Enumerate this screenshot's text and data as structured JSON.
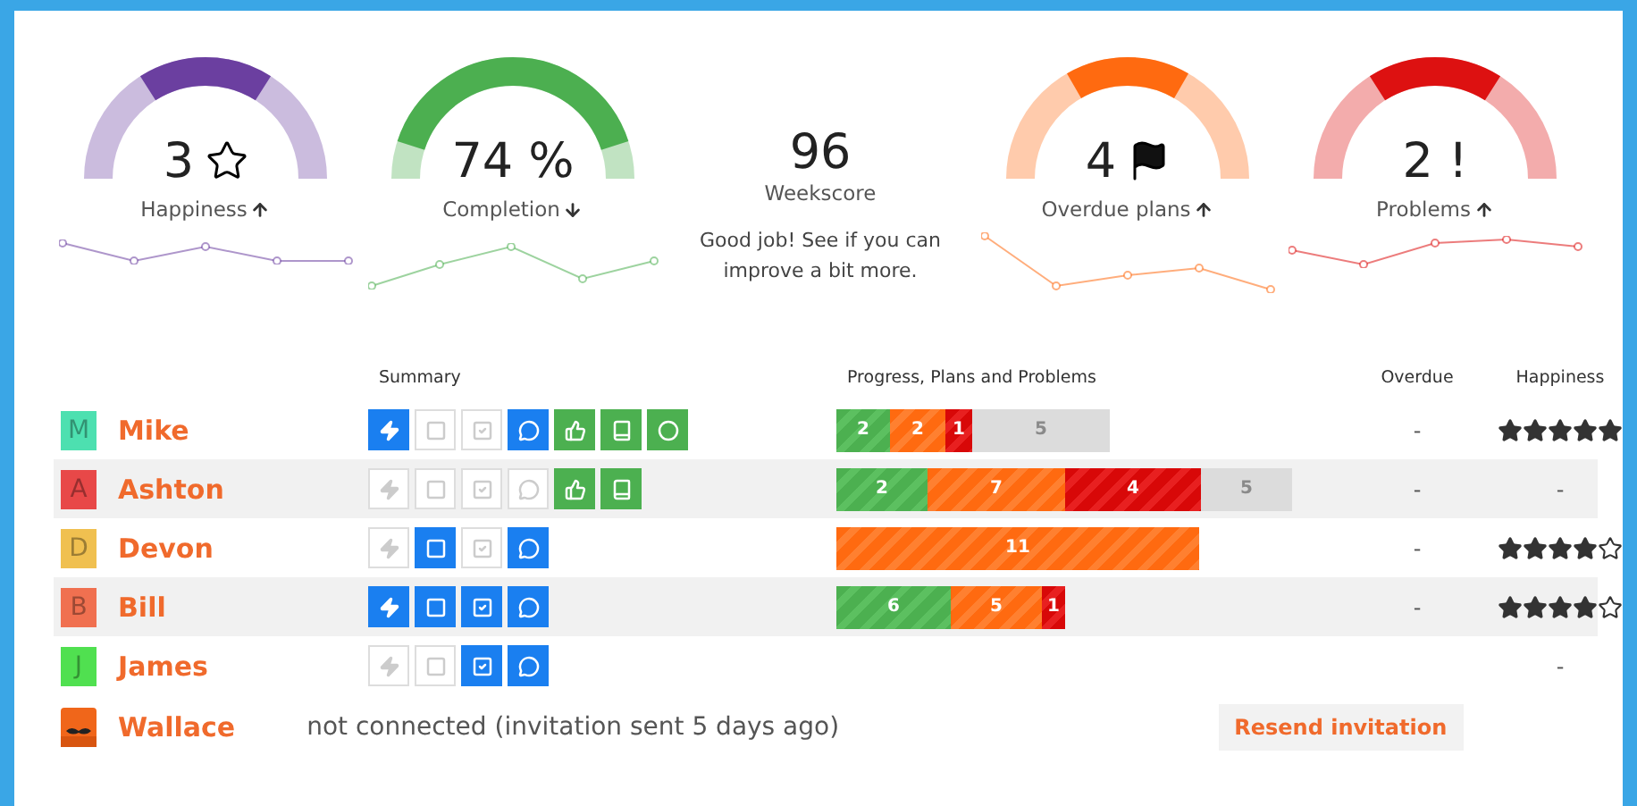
{
  "stats": [
    {
      "kind": "happiness",
      "value": "3",
      "label": "Happiness",
      "color": "#6b3fa0"
    },
    {
      "kind": "completion",
      "value": "74 %",
      "label": "Completion",
      "color": "#4caf50"
    },
    {
      "kind": "score",
      "value": "96",
      "label": "Weekscore",
      "note": "Good job! See if you can improve a bit more."
    },
    {
      "kind": "overdue",
      "value": "4",
      "label": "Overdue plans",
      "color": "#ff6a10"
    },
    {
      "kind": "problems",
      "value": "2 !",
      "label": "Problems",
      "color": "#dd1111"
    }
  ],
  "table": {
    "columns": [
      "Summary",
      "Progress, Plans and Problems",
      "Overdue",
      "Happiness"
    ],
    "rows": [
      {
        "initial": "M",
        "name": "Mike",
        "summary": [
          {
            "kind": "bolt",
            "on": true
          },
          {
            "kind": "square",
            "on": false
          },
          {
            "kind": "check",
            "on": false
          },
          {
            "kind": "chat",
            "on": true
          }
        ],
        "badges": [
          {
            "kind": "thumbs"
          },
          {
            "kind": "book"
          },
          {
            "kind": "circle"
          }
        ],
        "bar": [
          {
            "kind": "done",
            "value": "2"
          },
          {
            "kind": "plan",
            "value": "2"
          },
          {
            "kind": "problem",
            "value": "1"
          },
          {
            "kind": "rest",
            "value": "5"
          }
        ],
        "overdue": "-",
        "stars": 5
      },
      {
        "initial": "A",
        "name": "Ashton",
        "summary": [
          {
            "kind": "bolt",
            "on": false
          },
          {
            "kind": "square",
            "on": false
          },
          {
            "kind": "check",
            "on": false
          },
          {
            "kind": "chat",
            "on": false
          }
        ],
        "badges": [
          {
            "kind": "thumbs"
          },
          {
            "kind": "book"
          }
        ],
        "bar": [
          {
            "kind": "done",
            "value": "2"
          },
          {
            "kind": "plan",
            "value": "7"
          },
          {
            "kind": "problem",
            "value": "4"
          },
          {
            "kind": "rest",
            "value": "5"
          }
        ],
        "overdue": "-",
        "happiness": "-"
      },
      {
        "initial": "D",
        "name": "Devon",
        "summary": [
          {
            "kind": "bolt",
            "on": false
          },
          {
            "kind": "square",
            "on": true
          },
          {
            "kind": "check",
            "on": false
          },
          {
            "kind": "chat",
            "on": true
          }
        ],
        "bar": [
          {
            "kind": "plan",
            "value": "11"
          }
        ],
        "overdue": "-",
        "stars": 4
      },
      {
        "initial": "B",
        "name": "Bill",
        "summary": [
          {
            "kind": "bolt",
            "on": true
          },
          {
            "kind": "square",
            "on": true
          },
          {
            "kind": "check",
            "on": true
          },
          {
            "kind": "chat",
            "on": true
          }
        ],
        "bar": [
          {
            "kind": "done",
            "value": "6"
          },
          {
            "kind": "plan",
            "value": "5"
          },
          {
            "kind": "problem",
            "value": "1"
          }
        ],
        "overdue": "-",
        "stars": 4
      },
      {
        "initial": "J",
        "name": "James",
        "summary": [
          {
            "kind": "bolt",
            "on": false
          },
          {
            "kind": "square",
            "on": false
          },
          {
            "kind": "check",
            "on": true
          },
          {
            "kind": "chat",
            "on": true
          }
        ],
        "happiness": "-"
      },
      {
        "kind": "picture",
        "name": "Wallace",
        "note": "not connected (invitation sent 5 days ago)",
        "action": "Resend invitation"
      }
    ]
  }
}
